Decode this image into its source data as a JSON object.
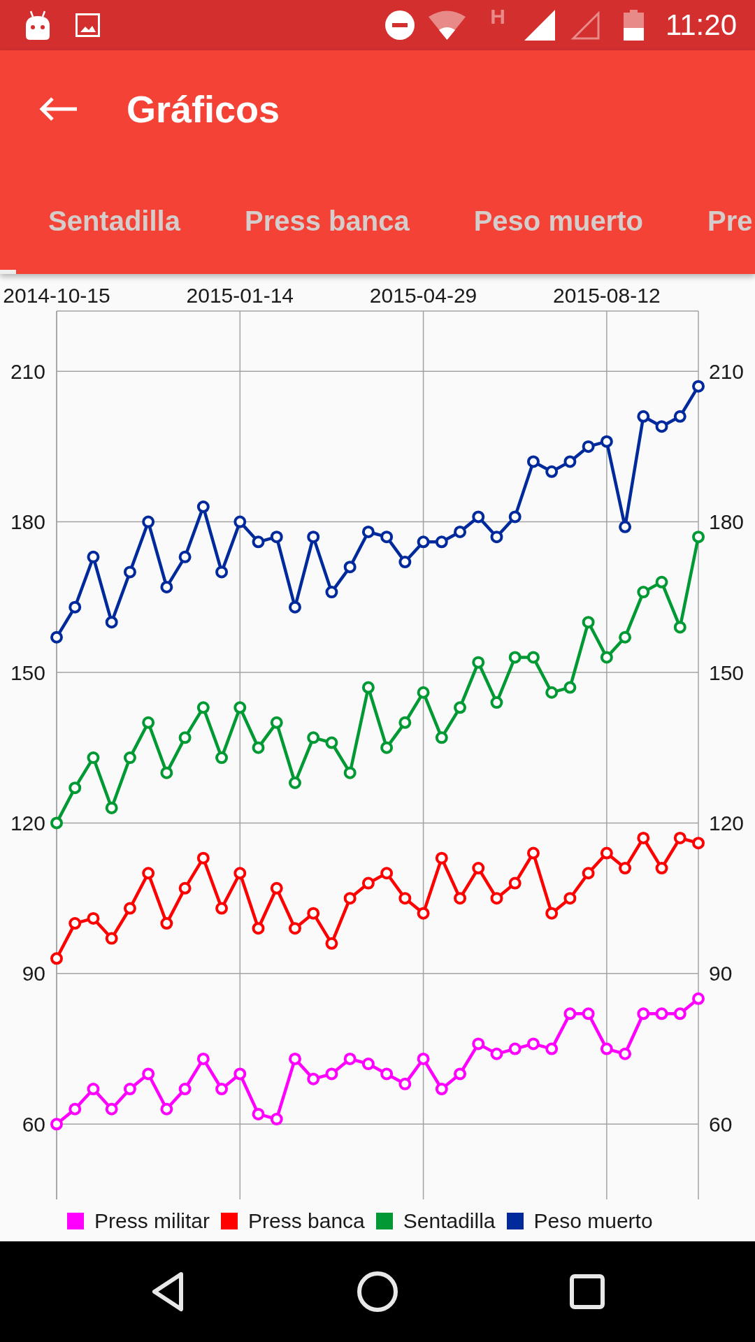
{
  "status_bar": {
    "network_type": "H",
    "time": "11:20"
  },
  "toolbar": {
    "title": "Gráficos"
  },
  "tabs": [
    {
      "label": "Sentadilla",
      "selected": false
    },
    {
      "label": "Press banca",
      "selected": false
    },
    {
      "label": "Peso muerto",
      "selected": false
    },
    {
      "label": "Pre",
      "selected": false
    }
  ],
  "chart": {
    "chart_data": {
      "type": "line",
      "categories": [
        "2014-10-15",
        null,
        null,
        null,
        null,
        null,
        null,
        null,
        null,
        null,
        "2015-01-14",
        null,
        null,
        null,
        null,
        null,
        null,
        null,
        null,
        null,
        "2015-04-29",
        null,
        null,
        null,
        null,
        null,
        null,
        null,
        null,
        null,
        "2015-08-12",
        null,
        null,
        null,
        null,
        null
      ],
      "ylim": [
        45,
        222
      ],
      "yticks": [
        60,
        90,
        120,
        150,
        180,
        210
      ],
      "grid": true,
      "legend": "bottom",
      "series": [
        {
          "name": "Press militar",
          "color": "#ff00ff",
          "marker": "circle",
          "values": [
            60,
            63,
            67,
            63,
            67,
            70,
            63,
            67,
            73,
            67,
            70,
            62,
            61,
            73,
            69,
            70,
            73,
            72,
            70,
            68,
            73,
            67,
            70,
            76,
            74,
            75,
            76,
            75,
            82,
            82,
            75,
            74,
            82,
            82,
            82,
            85
          ]
        },
        {
          "name": "Press banca",
          "color": "#ff0000",
          "marker": "circle",
          "values": [
            93,
            100,
            101,
            97,
            103,
            110,
            100,
            107,
            113,
            103,
            110,
            99,
            107,
            99,
            102,
            96,
            105,
            108,
            110,
            105,
            102,
            113,
            105,
            111,
            105,
            108,
            114,
            102,
            105,
            110,
            114,
            111,
            117,
            111,
            117,
            116
          ]
        },
        {
          "name": "Sentadilla",
          "color": "#009933",
          "marker": "circle",
          "values": [
            120,
            127,
            133,
            123,
            133,
            140,
            130,
            137,
            143,
            133,
            143,
            135,
            140,
            128,
            137,
            136,
            130,
            147,
            135,
            140,
            146,
            137,
            143,
            152,
            144,
            153,
            153,
            146,
            147,
            160,
            153,
            157,
            166,
            168,
            159,
            177
          ]
        },
        {
          "name": "Peso muerto",
          "color": "#002a9c",
          "marker": "circle",
          "values": [
            157,
            163,
            173,
            160,
            170,
            180,
            167,
            173,
            183,
            170,
            180,
            176,
            177,
            163,
            177,
            166,
            171,
            178,
            177,
            172,
            176,
            176,
            178,
            181,
            177,
            181,
            192,
            190,
            192,
            195,
            196,
            179,
            201,
            199,
            201,
            207
          ]
        }
      ]
    },
    "left_axis_labels": [
      "210",
      "180",
      "150",
      "120",
      "90",
      "60"
    ],
    "right_axis_labels": [
      "210",
      "180",
      "150",
      "120",
      "90",
      "60"
    ]
  }
}
